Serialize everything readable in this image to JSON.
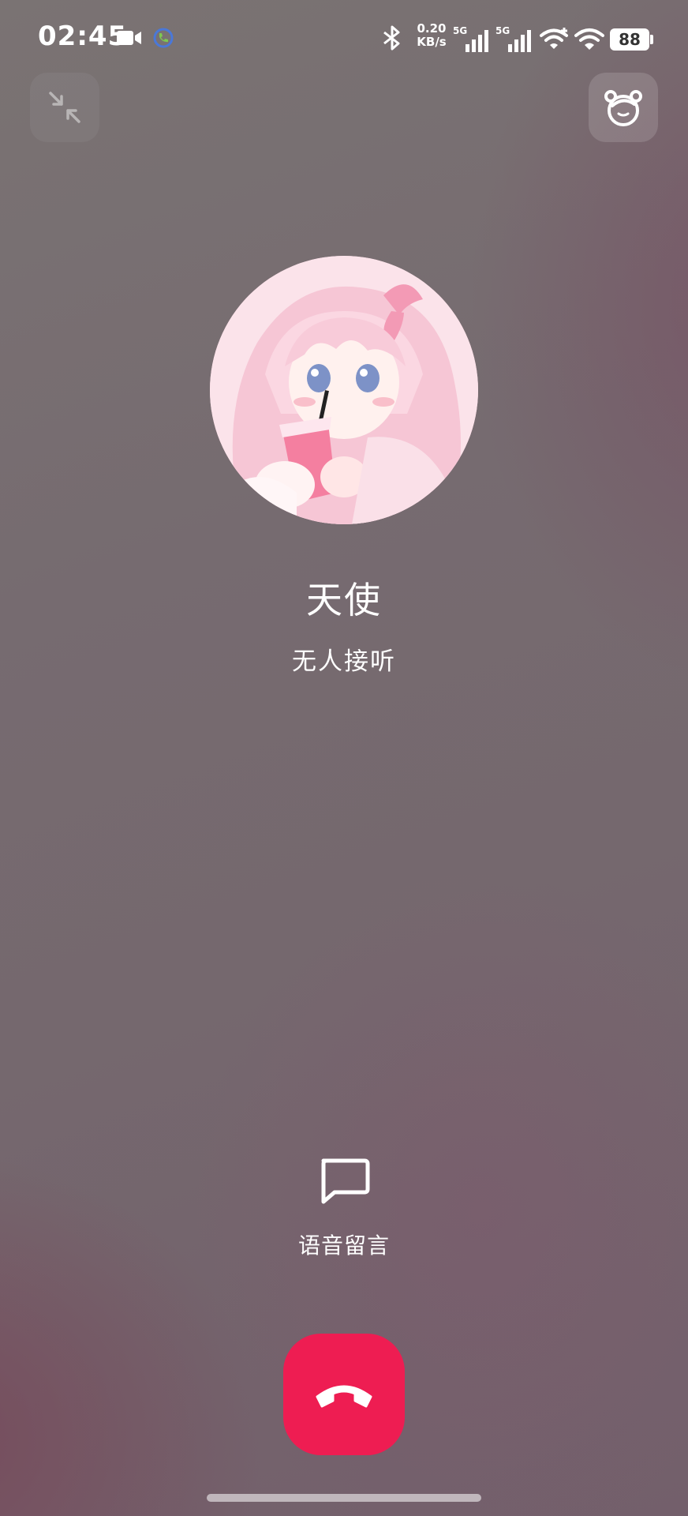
{
  "status_bar": {
    "time": "02:45",
    "network_speed": "0.20\nKB/s",
    "network_speed_value": "0.20",
    "network_speed_unit": "KB/s",
    "signal1_type": "5G",
    "signal2_type": "5G",
    "battery": "88",
    "icons": [
      "video-camera-icon",
      "call-in-progress-icon",
      "bluetooth-icon",
      "signal-icon",
      "signal-icon",
      "wifi-plus-icon",
      "wifi-icon",
      "battery-icon"
    ]
  },
  "top_actions": {
    "minimize_icon": "collapse-arrows-icon",
    "avatar_mode_icon": "cartoon-avatar-icon"
  },
  "contact": {
    "name": "天使",
    "status": "无人接听"
  },
  "actions": {
    "voicemail_label": "语音留言",
    "voicemail_icon": "message-bubble-icon",
    "hangup_icon": "hang-up-phone-icon"
  },
  "colors": {
    "hangup": "#ee1d52",
    "background": "#766b70"
  }
}
